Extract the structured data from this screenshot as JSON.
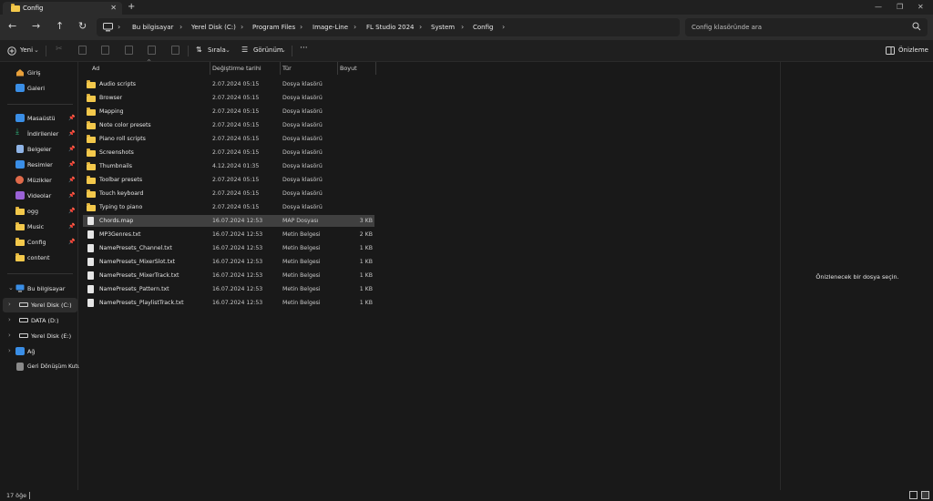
{
  "window": {
    "tab_title": "Config",
    "tab_close": "✕",
    "new_tab": "+",
    "controls": [
      "—",
      "❐",
      "✕"
    ]
  },
  "nav": {
    "back": "←",
    "forward": "→",
    "up": "↑",
    "refresh": "↻",
    "breadcrumbs": [
      "Bu bilgisayar",
      "Yerel Disk (C:)",
      "Program Files",
      "Image-Line",
      "FL Studio 2024",
      "System",
      "Config"
    ],
    "separator": "›",
    "search_placeholder": "Config klasöründe ara"
  },
  "toolbar": {
    "new_label": "Yeni",
    "sort_label": "Sırala",
    "view_label": "Görünüm",
    "more_label": "···",
    "preview_label": "Önizleme"
  },
  "sidebar": {
    "quick": [
      {
        "label": "Giriş",
        "icon": "home-icon"
      },
      {
        "label": "Galeri",
        "icon": "gallery-icon"
      }
    ],
    "pinned": [
      {
        "label": "Masaüstü",
        "icon": "desktop-icon",
        "color": "#3a8ee6"
      },
      {
        "label": "İndirilenler",
        "icon": "download-icon",
        "color": "#2fb47c"
      },
      {
        "label": "Belgeler",
        "icon": "documents-icon",
        "color": "#8fb4e6"
      },
      {
        "label": "Resimler",
        "icon": "pictures-icon",
        "color": "#3a8ee6"
      },
      {
        "label": "Müzikler",
        "icon": "music-icon",
        "color": "#e06a4a"
      },
      {
        "label": "Videolar",
        "icon": "videos-icon",
        "color": "#9a62d6"
      },
      {
        "label": "ogg",
        "icon": "folder-icon",
        "color": "#f3c84b"
      },
      {
        "label": "Music",
        "icon": "folder-icon",
        "color": "#f3c84b"
      },
      {
        "label": "Config",
        "icon": "folder-icon",
        "color": "#f3c84b"
      },
      {
        "label": "content",
        "icon": "folder-icon",
        "color": "#f3c84b"
      }
    ],
    "pin_glyph": "📌",
    "tree": [
      {
        "label": "Bu bilgisayar",
        "icon": "computer-icon",
        "chevron": "⌄"
      },
      {
        "label": "Yerel Disk (C:)",
        "icon": "drive-icon",
        "chevron": "›"
      },
      {
        "label": "DATA (D:)",
        "icon": "drive-icon",
        "chevron": "›"
      },
      {
        "label": "Yerel Disk (E:)",
        "icon": "drive-icon",
        "chevron": "›"
      },
      {
        "label": "Ağ",
        "icon": "network-icon",
        "chevron": "›"
      },
      {
        "label": "Geri Dönüşüm Kutusu",
        "icon": "recycle-bin-icon",
        "chevron": ""
      }
    ]
  },
  "columns": {
    "name": "Ad",
    "date": "Değiştirme tarihi",
    "type": "Tür",
    "size": "Boyut",
    "sort_caret": "^"
  },
  "files": [
    {
      "name": "Audio scripts",
      "date": "2.07.2024 05:15",
      "type": "Dosya klasörü",
      "size": "",
      "kind": "folder"
    },
    {
      "name": "Browser",
      "date": "2.07.2024 05:15",
      "type": "Dosya klasörü",
      "size": "",
      "kind": "folder"
    },
    {
      "name": "Mapping",
      "date": "2.07.2024 05:15",
      "type": "Dosya klasörü",
      "size": "",
      "kind": "folder"
    },
    {
      "name": "Note color presets",
      "date": "2.07.2024 05:15",
      "type": "Dosya klasörü",
      "size": "",
      "kind": "folder"
    },
    {
      "name": "Piano roll scripts",
      "date": "2.07.2024 05:15",
      "type": "Dosya klasörü",
      "size": "",
      "kind": "folder"
    },
    {
      "name": "Screenshots",
      "date": "2.07.2024 05:15",
      "type": "Dosya klasörü",
      "size": "",
      "kind": "folder"
    },
    {
      "name": "Thumbnails",
      "date": "4.12.2024 01:35",
      "type": "Dosya klasörü",
      "size": "",
      "kind": "folder"
    },
    {
      "name": "Toolbar presets",
      "date": "2.07.2024 05:15",
      "type": "Dosya klasörü",
      "size": "",
      "kind": "folder"
    },
    {
      "name": "Touch keyboard",
      "date": "2.07.2024 05:15",
      "type": "Dosya klasörü",
      "size": "",
      "kind": "folder"
    },
    {
      "name": "Typing to piano",
      "date": "2.07.2024 05:15",
      "type": "Dosya klasörü",
      "size": "",
      "kind": "folder"
    },
    {
      "name": "Chords.map",
      "date": "16.07.2024 12:53",
      "type": "MAP Dosyası",
      "size": "3 KB",
      "kind": "file",
      "selected": true
    },
    {
      "name": "MP3Genres.txt",
      "date": "16.07.2024 12:53",
      "type": "Metin Belgesi",
      "size": "2 KB",
      "kind": "file"
    },
    {
      "name": "NamePresets_Channel.txt",
      "date": "16.07.2024 12:53",
      "type": "Metin Belgesi",
      "size": "1 KB",
      "kind": "file"
    },
    {
      "name": "NamePresets_MixerSlot.txt",
      "date": "16.07.2024 12:53",
      "type": "Metin Belgesi",
      "size": "1 KB",
      "kind": "file"
    },
    {
      "name": "NamePresets_MixerTrack.txt",
      "date": "16.07.2024 12:53",
      "type": "Metin Belgesi",
      "size": "1 KB",
      "kind": "file"
    },
    {
      "name": "NamePresets_Pattern.txt",
      "date": "16.07.2024 12:53",
      "type": "Metin Belgesi",
      "size": "1 KB",
      "kind": "file"
    },
    {
      "name": "NamePresets_PlaylistTrack.txt",
      "date": "16.07.2024 12:53",
      "type": "Metin Belgesi",
      "size": "1 KB",
      "kind": "file"
    }
  ],
  "preview": {
    "message": "Önizlenecek bir dosya seçin."
  },
  "status": {
    "count": "17 öğe"
  },
  "colors": {
    "folder": "#f3c84b",
    "accent": "#3a8ee6",
    "selection": "#404040"
  }
}
